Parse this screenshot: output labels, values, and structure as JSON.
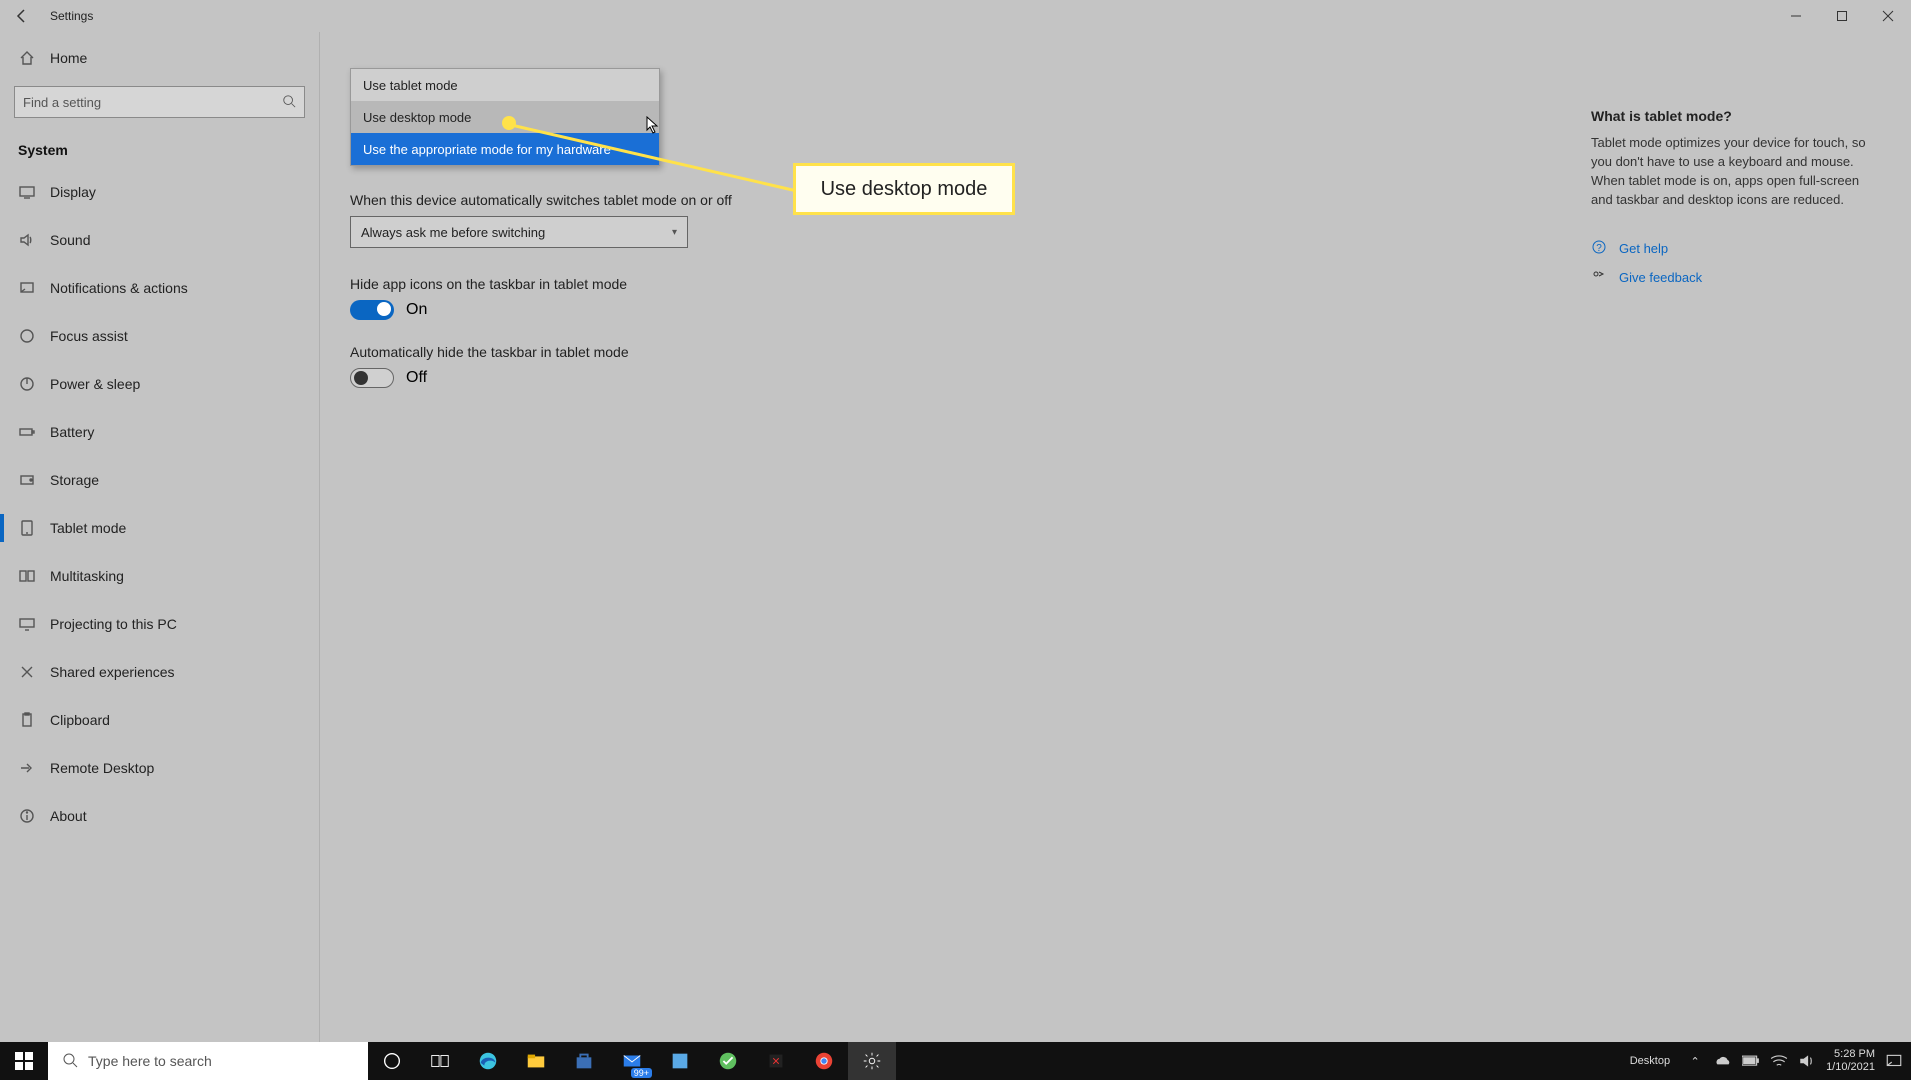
{
  "window": {
    "title": "Settings"
  },
  "sidebar": {
    "home": "Home",
    "search_placeholder": "Find a setting",
    "category": "System",
    "items": [
      {
        "label": "Display"
      },
      {
        "label": "Sound"
      },
      {
        "label": "Notifications & actions"
      },
      {
        "label": "Focus assist"
      },
      {
        "label": "Power & sleep"
      },
      {
        "label": "Battery"
      },
      {
        "label": "Storage"
      },
      {
        "label": "Tablet mode"
      },
      {
        "label": "Multitasking"
      },
      {
        "label": "Projecting to this PC"
      },
      {
        "label": "Shared experiences"
      },
      {
        "label": "Clipboard"
      },
      {
        "label": "Remote Desktop"
      },
      {
        "label": "About"
      }
    ]
  },
  "dropdown": {
    "opt1": "Use tablet mode",
    "opt2": "Use desktop mode",
    "opt3": "Use the appropriate mode for my hardware"
  },
  "main": {
    "switch_label": "When this device automatically switches tablet mode on or off",
    "switch_value": "Always ask me before switching",
    "hide_icons_label": "Hide app icons on the taskbar in tablet mode",
    "hide_icons_value": "On",
    "hide_taskbar_label": "Automatically hide the taskbar in tablet mode",
    "hide_taskbar_value": "Off"
  },
  "right": {
    "heading": "What is tablet mode?",
    "body": "Tablet mode optimizes your device for touch, so you don't have to use a keyboard and mouse. When tablet mode is on, apps open full-screen and taskbar and desktop icons are reduced.",
    "help": "Get help",
    "feedback": "Give feedback"
  },
  "callout": {
    "text": "Use desktop mode"
  },
  "taskbar": {
    "search_placeholder": "Type here to search",
    "desktop_label": "Desktop",
    "time": "5:28 PM",
    "date": "1/10/2021",
    "badge": "99+"
  }
}
